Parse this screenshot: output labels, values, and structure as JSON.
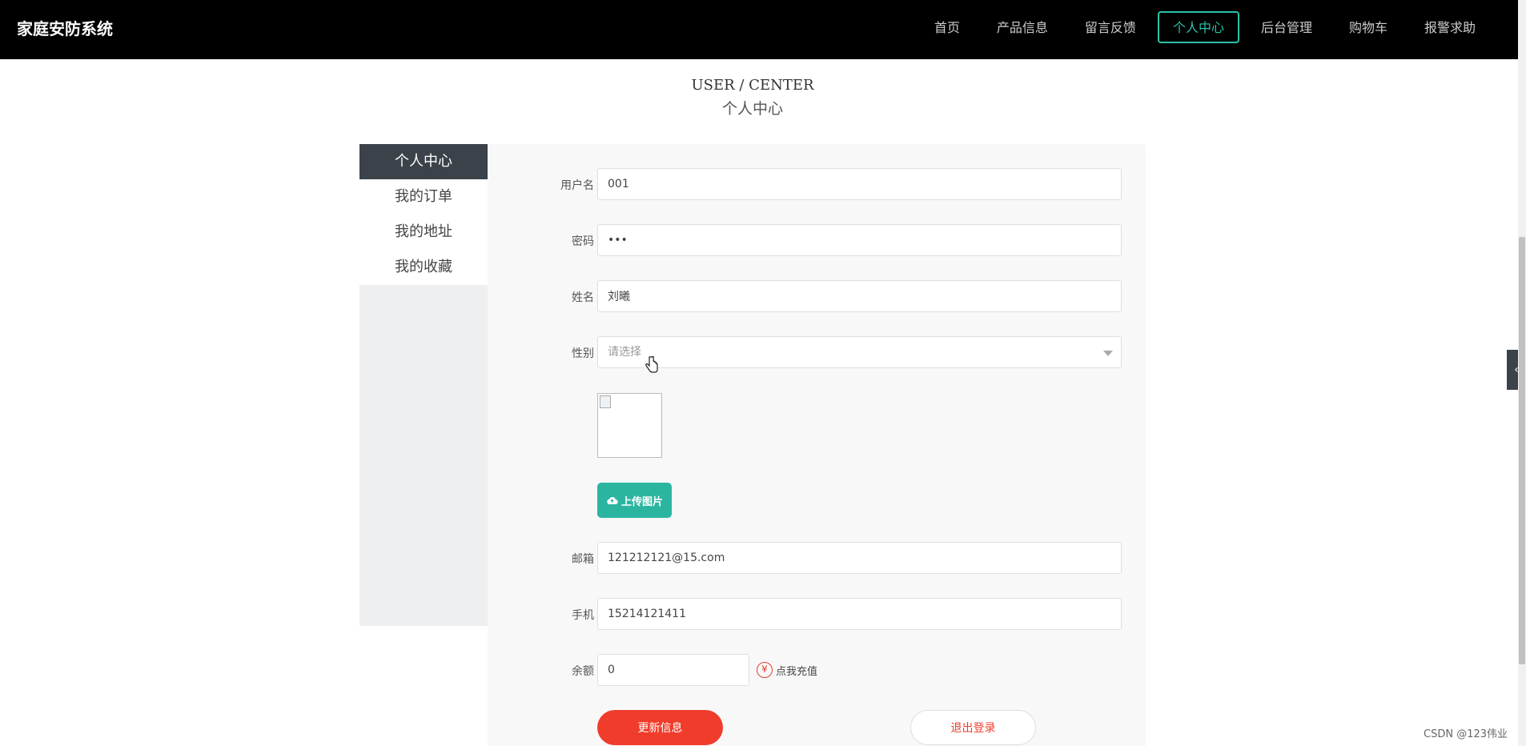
{
  "app_title": "家庭安防系统",
  "nav": {
    "items": [
      "首页",
      "产品信息",
      "留言反馈",
      "个人中心",
      "后台管理",
      "购物车",
      "报警求助"
    ],
    "active": "个人中心"
  },
  "heading": {
    "en": "USER / CENTER",
    "cn": "个人中心"
  },
  "sidebar": {
    "items": [
      "个人中心",
      "我的订单",
      "我的地址",
      "我的收藏"
    ],
    "active": "个人中心"
  },
  "form": {
    "username": {
      "label": "用户名",
      "value": "001"
    },
    "password": {
      "label": "密码",
      "value": "•••"
    },
    "name": {
      "label": "姓名",
      "value": "刘曦"
    },
    "gender": {
      "label": "性别",
      "placeholder": "请选择"
    },
    "upload_label": "上传图片",
    "email": {
      "label": "邮箱",
      "value": "121212121@15.com"
    },
    "phone": {
      "label": "手机",
      "value": "15214121411"
    },
    "balance": {
      "label": "余额",
      "value": "0",
      "recharge_icon": "¥",
      "recharge_label": "点我充值"
    },
    "update_button": "更新信息",
    "logout_button": "退出登录"
  },
  "side_tab_icon": "‹",
  "watermark": "CSDN @123伟业",
  "colors": {
    "accent": "#2bc2a8",
    "danger": "#f03c2b",
    "nav_bg": "#000000",
    "sidebar_active": "#3b4249"
  }
}
